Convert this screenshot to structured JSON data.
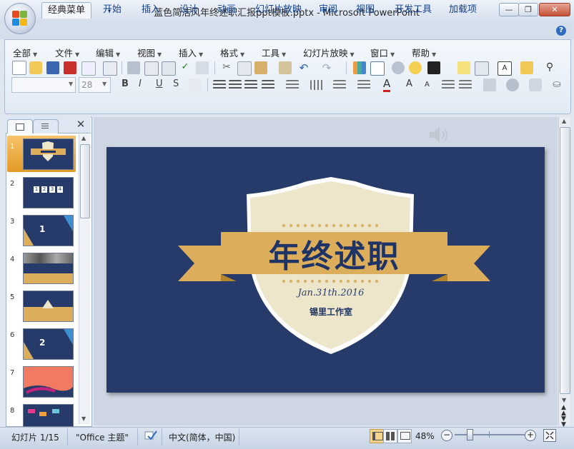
{
  "window": {
    "title": "蓝色简洁风年终述职汇报ppt模板.pptx - Microsoft PowerPoint",
    "minimize": "—",
    "restore": "❐",
    "close": "✕"
  },
  "tabs": [
    "经典菜单",
    "开始",
    "插入",
    "设计",
    "动画",
    "幻灯片放映",
    "审阅",
    "视图",
    "开发工具",
    "加载项"
  ],
  "help": "?",
  "classic_menu": [
    "全部",
    "文件",
    "编辑",
    "视图",
    "插入",
    "格式",
    "工具",
    "幻灯片放映",
    "窗口",
    "帮助"
  ],
  "font": {
    "name": "",
    "size": "28"
  },
  "format_buttons": [
    "B",
    "I",
    "U",
    "S"
  ],
  "slides_panel": {
    "slide_numbers": [
      "1",
      "2",
      "3",
      "4",
      "5",
      "6",
      "7",
      "8"
    ],
    "thumb_texts": {
      "s2": [
        "1",
        "2",
        "3",
        "4"
      ],
      "s3": "1",
      "s6": "2"
    }
  },
  "slide": {
    "title": "年终述职",
    "date": "Jan.31th.2016",
    "author": "锡里工作室",
    "colors": {
      "background": "#263b6a",
      "shield": "#ede6cb",
      "ribbon": "#dcae5c",
      "ribbon_dark": "#b5852c",
      "title": "#1f3466"
    }
  },
  "status": {
    "slide_info": "幻灯片 1/15",
    "theme": "\"Office 主题\"",
    "language": "中文(简体，中国)",
    "zoom": "48%",
    "zoom_level": 0.48
  }
}
